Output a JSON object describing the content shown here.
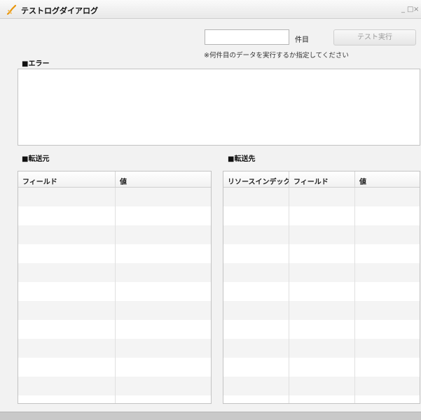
{
  "window": {
    "title": "テストログダイアログ",
    "controls": {
      "minimize": "_",
      "maximize": "□",
      "close": "×"
    }
  },
  "toolbar": {
    "count_value": "",
    "count_label": "件目",
    "run_label": "テスト実行",
    "hint": "※何件目のデータを実行するか指定してください"
  },
  "error_section": {
    "label": "■エラー"
  },
  "source_section": {
    "label": "■転送元",
    "columns": [
      "フィールド",
      "値"
    ]
  },
  "dest_section": {
    "label": "■転送先",
    "columns": [
      "リソースインデックス",
      "フィールド",
      "値"
    ]
  },
  "colors": {
    "accent_icon": "#e8960c",
    "disabled_text": "#9a9a9a"
  }
}
